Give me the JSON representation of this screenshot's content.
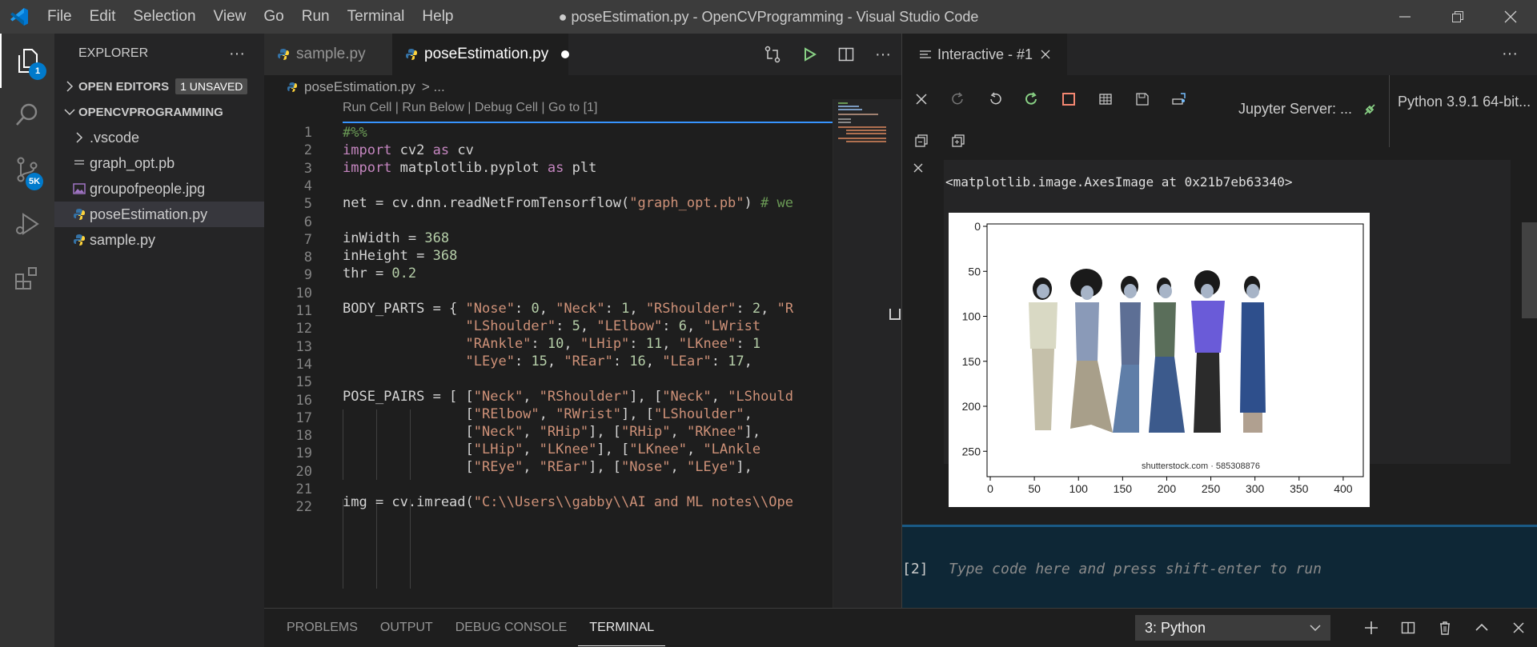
{
  "titlebar": {
    "menu": [
      "File",
      "Edit",
      "Selection",
      "View",
      "Go",
      "Run",
      "Terminal",
      "Help"
    ],
    "title": "● poseEstimation.py - OpenCVProgramming - Visual Studio Code"
  },
  "activity": {
    "explorer_badge": "1",
    "scm_badge": "5K"
  },
  "sidebar": {
    "title": "EXPLORER",
    "more": "···",
    "open_editors": "OPEN EDITORS",
    "unsaved": "1 UNSAVED",
    "project": "OPENCVPROGRAMMING",
    "files": [
      {
        "name": ".vscode",
        "icon": "folder-chevron"
      },
      {
        "name": "graph_opt.pb",
        "icon": "file-icon"
      },
      {
        "name": "groupofpeople.jpg",
        "icon": "image-icon"
      },
      {
        "name": "poseEstimation.py",
        "icon": "python-icon"
      },
      {
        "name": "sample.py",
        "icon": "python-icon"
      }
    ]
  },
  "editor": {
    "tabs": [
      {
        "label": "sample.py",
        "active": false
      },
      {
        "label": "poseEstimation.py",
        "active": true,
        "dirty": true
      }
    ],
    "breadcrumb": {
      "file": "poseEstimation.py",
      "rest": "> ..."
    },
    "codelens": "Run Cell | Run Below | Debug Cell | Go to [1]",
    "line_numbers": [
      "1",
      "2",
      "3",
      "4",
      "5",
      "6",
      "7",
      "8",
      "9",
      "10",
      "11",
      "12",
      "13",
      "14",
      "15",
      "16",
      "17",
      "18",
      "19",
      "20",
      "21",
      "22"
    ]
  },
  "interactive": {
    "tab_label": "Interactive - #1",
    "jupyter_server": "Jupyter Server: ...",
    "kernel": "Python 3.9.1 64-bit...",
    "output_text": "<matplotlib.image.AxesImage at 0x21b7eb63340>",
    "input_prompt": "[2]",
    "input_placeholder": "Type code here and press shift-enter to run",
    "plot_watermark": "shutterstock.com · 585308876"
  },
  "panel": {
    "tabs": [
      "PROBLEMS",
      "OUTPUT",
      "DEBUG CONSOLE",
      "TERMINAL"
    ],
    "active_tab": "TERMINAL",
    "terminal_select": "3: Python"
  },
  "colors": {
    "accent": "#007acc",
    "keyword": "#569cd6",
    "string": "#ce9178",
    "number": "#b5cea8",
    "comment": "#6a9955"
  },
  "chart_data": {
    "type": "image",
    "x_ticks": [
      "0",
      "50",
      "100",
      "150",
      "200",
      "250",
      "300",
      "350",
      "400"
    ],
    "y_ticks": [
      "0",
      "50",
      "100",
      "150",
      "200",
      "250"
    ],
    "xlim": [
      0,
      420
    ],
    "ylim": [
      290,
      0
    ]
  }
}
